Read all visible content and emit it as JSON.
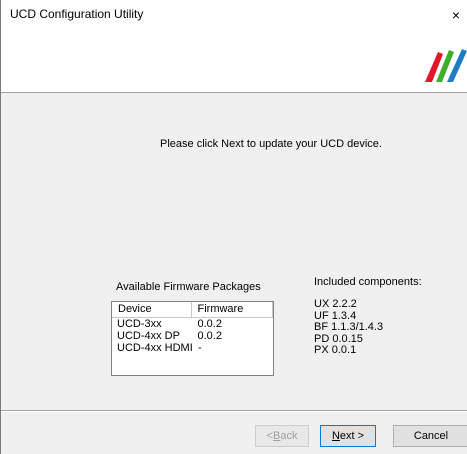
{
  "window": {
    "title": "UCD Configuration Utility",
    "close_glyph": "×"
  },
  "colors": {
    "logo_red": "#e3162b",
    "logo_green": "#3fae2a",
    "logo_blue": "#1c7cc8"
  },
  "main": {
    "instruction": "Please click Next to update your UCD device."
  },
  "firmware": {
    "title": "Available Firmware Packages",
    "columns": [
      "Device",
      "Firmware"
    ],
    "rows": [
      {
        "device": "UCD-3xx",
        "firmware": "0.0.2"
      },
      {
        "device": "UCD-4xx DP",
        "firmware": "0.0.2"
      },
      {
        "device": "UCD-4xx HDMI",
        "firmware": "-"
      }
    ]
  },
  "components": {
    "title": "Included components:",
    "items": [
      "UX 2.2.2",
      "UF 1.3.4",
      "BF 1.1.3/1.4.3",
      "PD 0.0.15",
      "PX 0.0.1"
    ]
  },
  "buttons": {
    "back_prefix": "< ",
    "back_mnemonic": "B",
    "back_rest": "ack",
    "next_mnemonic": "N",
    "next_rest": "ext >",
    "cancel": "Cancel"
  }
}
